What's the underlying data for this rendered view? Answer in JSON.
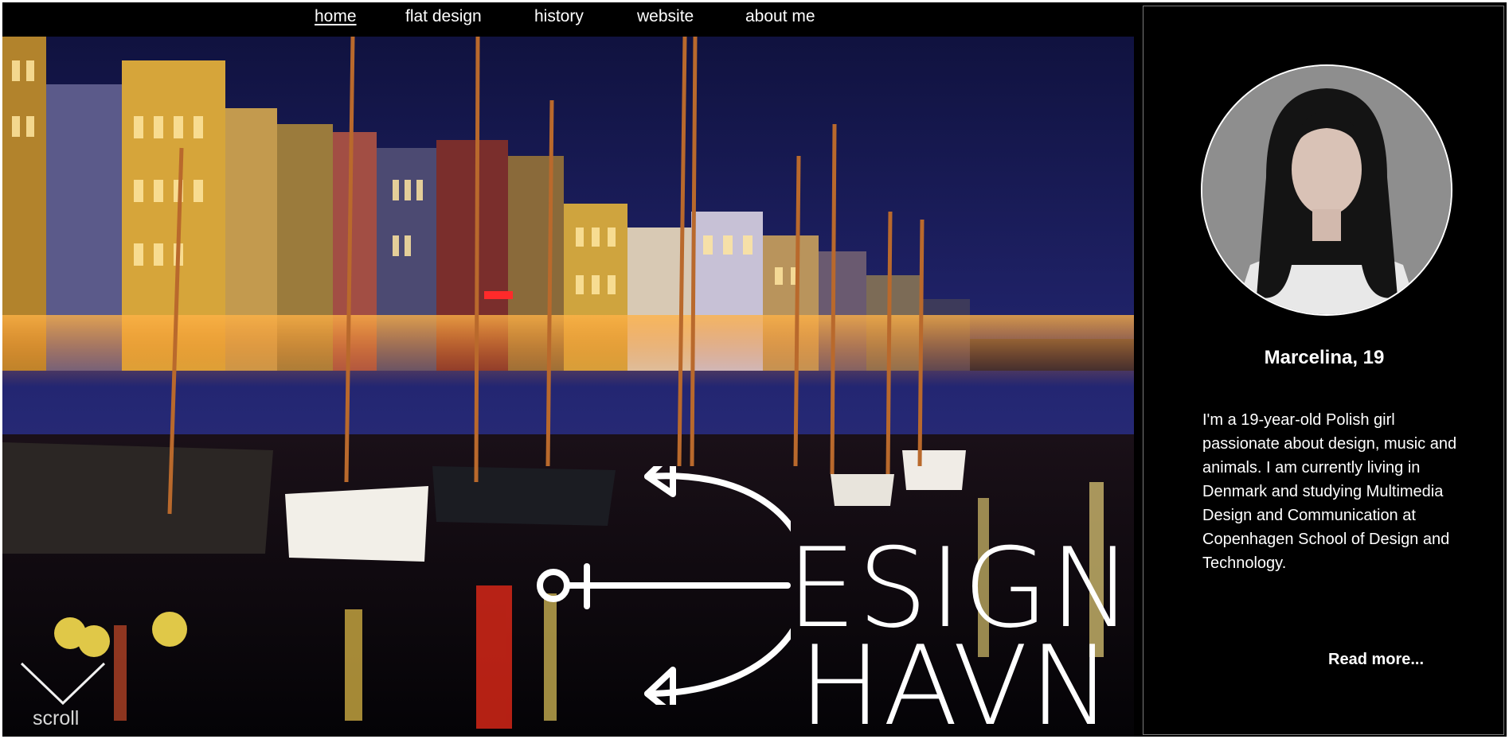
{
  "nav": {
    "items": [
      {
        "label": "home",
        "active": true
      },
      {
        "label": "flat design",
        "active": false
      },
      {
        "label": "history",
        "active": false
      },
      {
        "label": "website",
        "active": false
      },
      {
        "label": "about me",
        "active": false
      }
    ]
  },
  "hero": {
    "logo_line1": "ESIGN",
    "logo_line2": "HAVN",
    "scroll_label": "scroll"
  },
  "profile": {
    "name": "Marcelina, 19",
    "bio": "I'm a 19-year-old Polish girl passionate about design, music and animals. I am currently living in Denmark and studying Multimedia Design and Communication at Copenhagen School of Design and Technology.",
    "read_more": "Read more..."
  },
  "colors": {
    "background": "#000000",
    "text": "#ffffff",
    "sky": "#1b1e5a",
    "water": "#08060c"
  },
  "icons": [
    "anchor-icon",
    "chevron-down-icon"
  ]
}
